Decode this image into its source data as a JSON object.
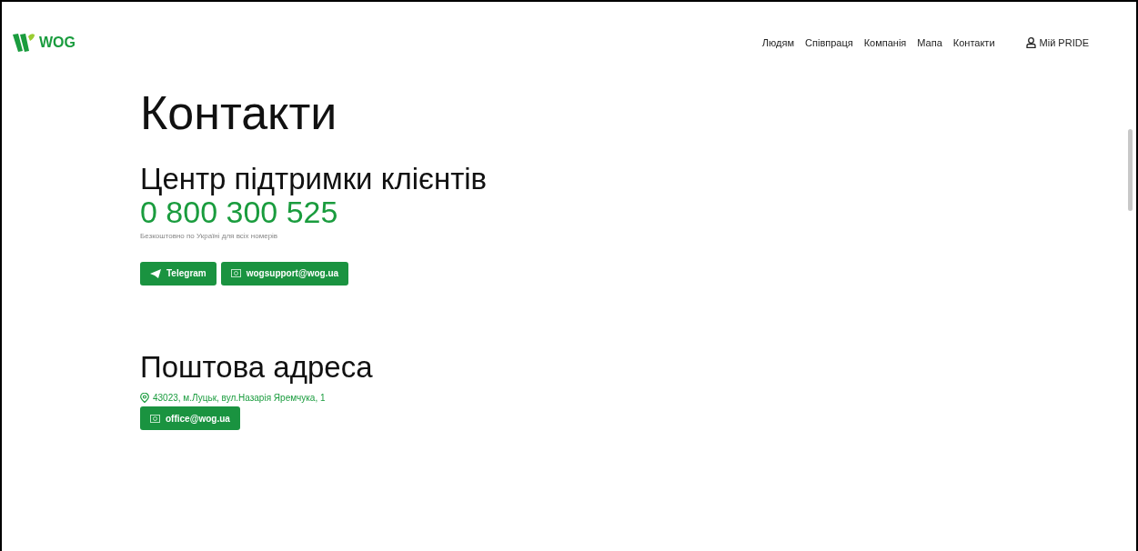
{
  "header": {
    "logo": "WOG",
    "nav": [
      {
        "label": "Людям"
      },
      {
        "label": "Співпраця"
      },
      {
        "label": "Компанія"
      },
      {
        "label": "Мапа"
      },
      {
        "label": "Контакти"
      }
    ],
    "account": "Мій PRIDE"
  },
  "title": "Контакти",
  "support": {
    "heading": "Центр підтримки клієнтів",
    "phone": "0 800 300 525",
    "note": "Безкоштовно по Україні для всіх номерів",
    "buttons": [
      {
        "kind": "telegram",
        "label": "Telegram"
      },
      {
        "kind": "email",
        "label": "wogsupport@wog.ua"
      }
    ]
  },
  "postal": {
    "heading": "Поштова адреса",
    "address": "43023, м.Луцьк, вул.Назарія Яремчука, 1",
    "buttons": [
      {
        "kind": "email",
        "label": "office@wog.ua"
      }
    ]
  }
}
